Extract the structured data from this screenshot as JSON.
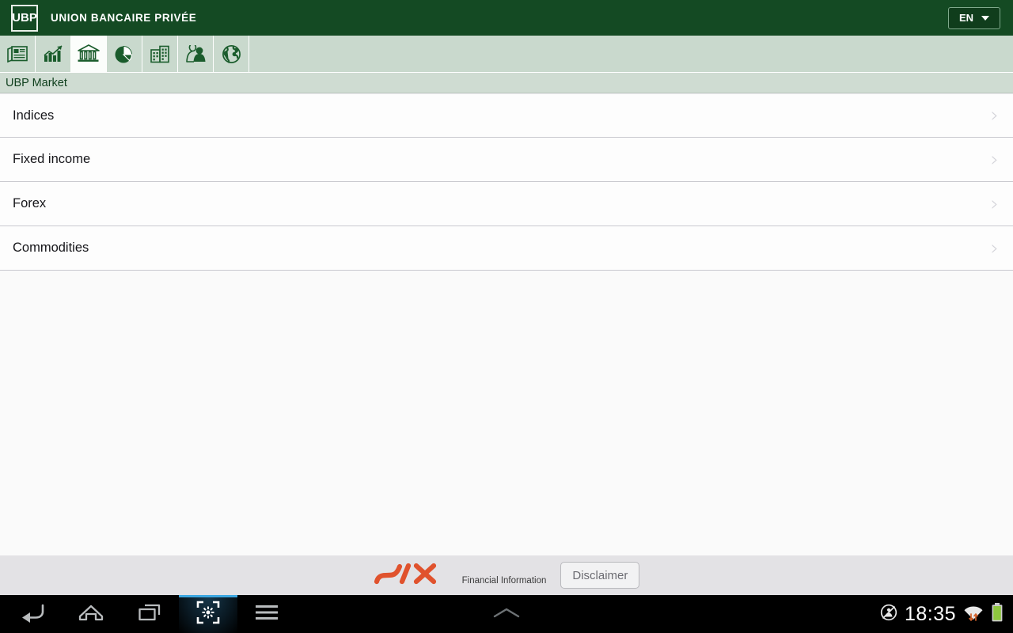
{
  "header": {
    "logo_text": "UBP",
    "brand_name": "UNION BANCAIRE PRIVÉE",
    "language": {
      "selected": "EN",
      "icon": "chevron-down-icon"
    }
  },
  "toolbar": {
    "tabs": [
      {
        "name": "news",
        "icon": "newspaper-icon",
        "active": false
      },
      {
        "name": "markets",
        "icon": "bar-chart-icon",
        "active": false
      },
      {
        "name": "ubp-market",
        "icon": "bank-icon",
        "active": true
      },
      {
        "name": "portfolio",
        "icon": "pie-chart-icon",
        "active": false
      },
      {
        "name": "companies",
        "icon": "buildings-icon",
        "active": false
      },
      {
        "name": "contacts",
        "icon": "people-icon",
        "active": false
      },
      {
        "name": "global",
        "icon": "globe-icon",
        "active": false
      }
    ]
  },
  "page": {
    "title": "UBP Market"
  },
  "list": {
    "rows": [
      {
        "label": "Indices",
        "chevron": "›"
      },
      {
        "label": "Fixed income",
        "chevron": "›"
      },
      {
        "label": "Forex",
        "chevron": "›"
      },
      {
        "label": "Commodities",
        "chevron": "›"
      }
    ]
  },
  "footer": {
    "provider_logo": "six-logo",
    "provider_caption": "Financial Information",
    "disclaimer_label": "Disclaimer"
  },
  "navbar": {
    "buttons": [
      {
        "name": "back",
        "icon": "back-arrow-icon",
        "highlight": false
      },
      {
        "name": "home",
        "icon": "home-icon",
        "highlight": false
      },
      {
        "name": "recents",
        "icon": "recent-apps-icon",
        "highlight": false
      },
      {
        "name": "screenshot",
        "icon": "capture-icon",
        "highlight": true
      },
      {
        "name": "menu",
        "icon": "menu-icon",
        "highlight": false
      }
    ],
    "expand_icon": "chevron-up-icon",
    "status": {
      "mute_icon": "mute-icon",
      "time": "18:35",
      "wifi_icon": "wifi-icon",
      "battery_icon": "battery-full-icon"
    }
  },
  "colors": {
    "header_green": "#144a23",
    "toolbar_green": "#c9d9cd",
    "title_bar": "#cfdcd2",
    "accent_orange": "#e0522d",
    "battery_green": "#8ec63f",
    "highlight_blue": "#3ca7e0"
  }
}
